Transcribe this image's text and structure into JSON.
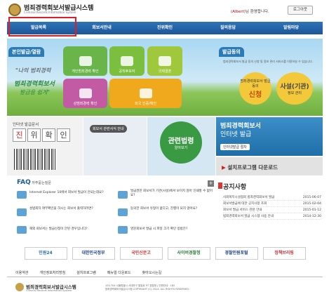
{
  "header": {
    "title": "범죄경력회보서발급시스템",
    "subtitle": "Criminal Records Information System",
    "user_name": "Albert",
    "welcome_suffix": "님 환영합니다.",
    "logout_label": "로그아웃"
  },
  "nav": {
    "items": [
      "발급목록",
      "회보서안내",
      "진위확인",
      "질의응답",
      "알림마당"
    ],
    "highlight_color": "#e31b23"
  },
  "hero": {
    "left_tab": "본인발급/열람",
    "slogan_line1": "\"나의 범죄경력",
    "slogan_line2": "범죄경력회보서",
    "slogan_line3": "발급을 쉽게\"",
    "tiles": [
      "개인범죄경력 확인",
      "공직후보자",
      "국제결혼",
      "성범죄경력 확인",
      "외국 인증/확인"
    ],
    "right_tab": "발급동의",
    "consent_desc": "범죄경력회보서 발급 동의 신청 및 정보 관리 서비스를 이용하실 수 있습니다.",
    "consent_apply_small": "범죄경력회보서 발급동의",
    "consent_apply_big": "신청",
    "consent_manage_big": "사설(기관)",
    "consent_manage_sub": "정보 관리"
  },
  "banners": {
    "verify_small": "인터넷 발급문서",
    "verify_chars": [
      "진",
      "위",
      "확",
      "인"
    ],
    "guide_label": "회보서 관련서식 안내",
    "guide2_big": "관련법령",
    "guide2_small": "알아보기",
    "internet_title": "범죄경력회보서",
    "internet_sub": "인터넷 발급",
    "internet_btn": "인터넷발급 절차",
    "install_label": "설치프로그램",
    "install_suffix": " 다운로드"
  },
  "faq": {
    "title": "FAQ",
    "subtitle": " 자주묻는질문",
    "more": "+",
    "items": [
      "Internet Explorer 10에서 회보서 발급이 안되는데요?",
      "발급권한 회보서가 기관(사설)에서 보이지 않아 인쇄할 수 없어요?",
      "성범죄자 여부확인을 하시는 회보서 출력하려면?",
      "동의한 회보서 유형이 없다고, 진행이 되지 않아요?",
      "해외 회보서는 발급신청이 안된 경우입니다?",
      "영문회보서 발급 시 파일 크기 확인 방법은?"
    ]
  },
  "notice": {
    "title": "공지사항",
    "items": [
      {
        "text": "사회복지시설협회 범죄경력회보서 발급",
        "date": "2015-06-07"
      },
      {
        "text": "회보서발급에 대한 공지사항 조회",
        "date": "2015-02-04"
      },
      {
        "text": "회보서 발급 서비스 관련 안내",
        "date": "2015-01-12"
      },
      {
        "text": "범죄경력회보서 발급 시스템 사용 안내",
        "date": "2014-12-30"
      }
    ]
  },
  "partners": [
    "민원24",
    "대한민국정부",
    "국민신문고",
    "사이버경찰청",
    "경찰민원포털",
    "정책브리핑"
  ],
  "footer": {
    "links": [
      "이용약관",
      "개인정보처리방침",
      "설치프로그램",
      "메뉴얼 다운로드",
      "찾아오시는길"
    ],
    "title": "범죄경력회보서발급시스템",
    "subtitle": "Criminal Records Information System",
    "address": "120-704 서울특별시 서대문구 통일로 97 경찰청 | 민원안내 : 182",
    "copyright": "범죄경력회보서발급시스템 COPYRIGHT (C) 2014. ALL RIGHTS RESERVED."
  },
  "colors": {
    "nav": "#1c5697",
    "accent_red": "#e31b23"
  }
}
